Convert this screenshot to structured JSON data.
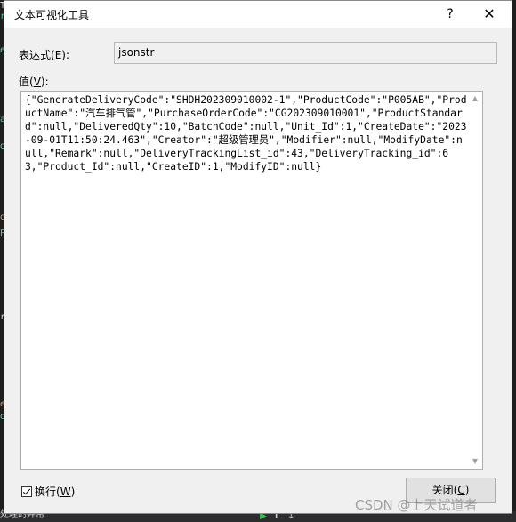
{
  "dialog": {
    "title": "文本可视化工具",
    "help_glyph": "?",
    "close_glyph": "✕"
  },
  "expression": {
    "label": "表达式(",
    "label_accel": "E",
    "label_end": "):",
    "value": "jsonstr"
  },
  "value_section": {
    "label": "值(",
    "label_accel": "V",
    "label_end": "):",
    "text": "{\"GenerateDeliveryCode\":\"SHDH202309010002-1\",\"ProductCode\":\"P005AB\",\"ProductName\":\"汽车排气管\",\"PurchaseOrderCode\":\"CG202309010001\",\"ProductStandard\":null,\"DeliveredQty\":10,\"BatchCode\":null,\"Unit_Id\":1,\"CreateDate\":\"2023-09-01T11:50:24.463\",\"Creator\":\"超级管理员\",\"Modifier\":null,\"ModifyDate\":null,\"Remark\":null,\"DeliveryTrackingList_id\":43,\"DeliveryTracking_id\":63,\"Product_Id\":null,\"CreateID\":1,\"ModifyID\":null}"
  },
  "wrap": {
    "label": "换行(",
    "label_accel": "W",
    "label_end": ")",
    "checked": true
  },
  "close_button": {
    "label": "关闭(",
    "label_accel": "C",
    "label_end": ")"
  },
  "background": {
    "bottom_text": "处理的异常",
    "watermark": "CSDN @上天试道者"
  },
  "icons": {
    "help": "question-mark-icon",
    "close": "close-x-icon",
    "scroll_up": "chevron-up-icon",
    "scroll_down": "chevron-down-icon"
  }
}
